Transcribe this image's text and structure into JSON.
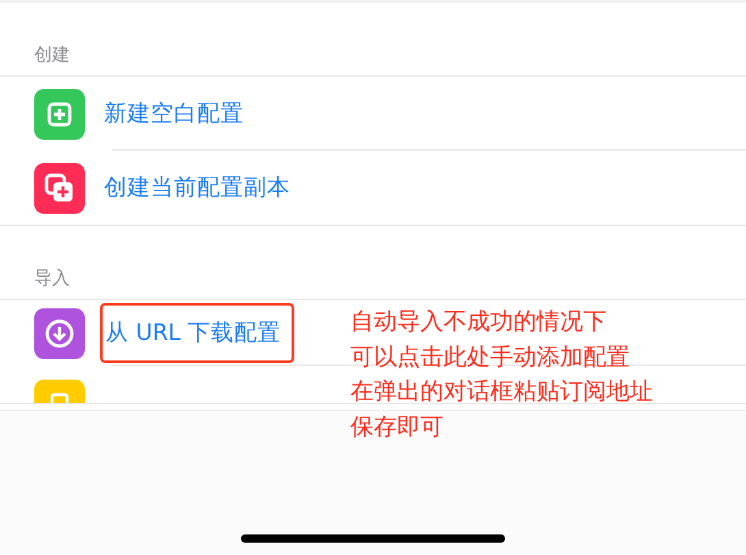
{
  "sections": [
    {
      "title": "创建",
      "items": [
        {
          "kind": "add",
          "color": "#34c759",
          "label": "新建空白配置",
          "highlighted": false
        },
        {
          "kind": "duplicate",
          "color": "#ff2d55",
          "label": "创建当前配置副本",
          "highlighted": false
        }
      ]
    },
    {
      "title": "导入",
      "items": [
        {
          "kind": "download",
          "color": "#af52de",
          "label": "从 URL 下载配置",
          "highlighted": true
        },
        {
          "kind": "partial",
          "color": "#ffcc00"
        }
      ]
    }
  ],
  "annotation": {
    "lines": [
      "自动导入不成功的情况下",
      "可以点击此处手动添加配置",
      "在弹出的对话框粘贴订阅地址",
      "保存即可"
    ]
  }
}
